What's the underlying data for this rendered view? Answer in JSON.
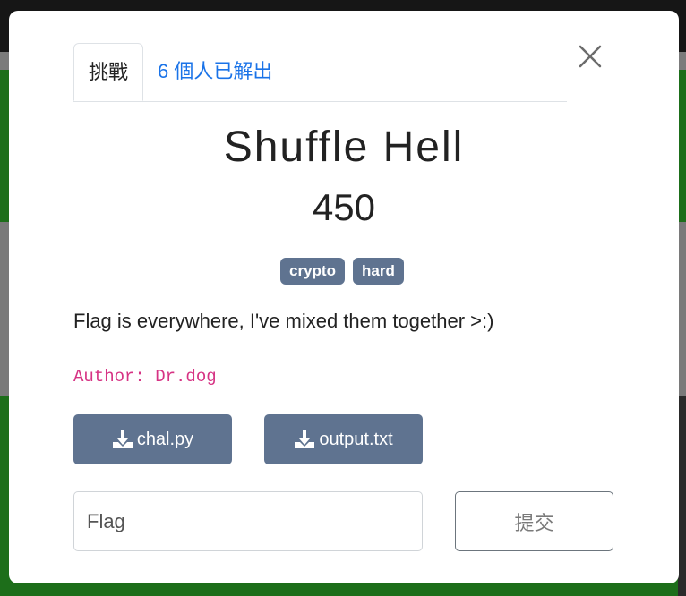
{
  "modal": {
    "tabs": [
      {
        "label": "挑戰"
      },
      {
        "label": "6 個人已解出"
      }
    ],
    "challenge": {
      "title": "Shuffle Hell",
      "points": "450",
      "tags": [
        "crypto",
        "hard"
      ],
      "description": "Flag is everywhere, I've mixed them together >:)",
      "author": "Author: Dr.dog"
    },
    "files": [
      {
        "name": "chal.py",
        "icon": "download-icon"
      },
      {
        "name": "output.txt",
        "icon": "download-icon"
      }
    ],
    "form": {
      "flag_placeholder": "Flag",
      "submit_label": "提交"
    },
    "close_icon": "close-icon"
  },
  "colors": {
    "accent_link": "#1a73e8",
    "tag_bg": "#5f7390",
    "author_text": "#d63384"
  }
}
